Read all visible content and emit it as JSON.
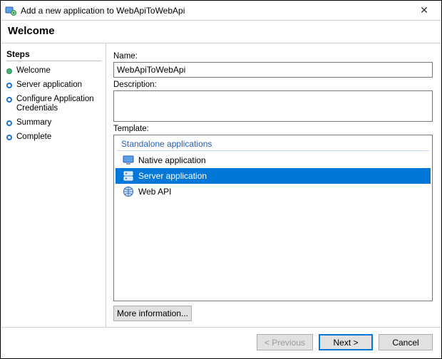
{
  "window": {
    "title": "Add a new application to WebApiToWebApi"
  },
  "header": "Welcome",
  "sidebar": {
    "heading": "Steps",
    "steps": [
      {
        "label": "Welcome",
        "state": "done"
      },
      {
        "label": "Server application",
        "state": "pending"
      },
      {
        "label": "Configure Application Credentials",
        "state": "pending"
      },
      {
        "label": "Summary",
        "state": "pending"
      },
      {
        "label": "Complete",
        "state": "pending"
      }
    ]
  },
  "main": {
    "name_label": "Name:",
    "name_value": "WebApiToWebApi",
    "description_label": "Description:",
    "description_value": "",
    "template_label": "Template:",
    "template_group": "Standalone applications",
    "templates": [
      {
        "label": "Native application",
        "selected": false
      },
      {
        "label": "Server application",
        "selected": true
      },
      {
        "label": "Web API",
        "selected": false
      }
    ],
    "more_info": "More information..."
  },
  "footer": {
    "previous": "< Previous",
    "next": "Next >",
    "cancel": "Cancel"
  }
}
